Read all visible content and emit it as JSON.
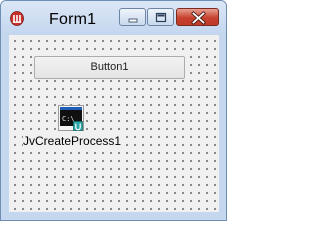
{
  "window": {
    "title": "Form1",
    "colors": {
      "frame": "#c4d7ee",
      "close_button": "#c7412e",
      "client_background": "#f0f0f0"
    },
    "icons": {
      "app": "delphi-app-icon",
      "minimize": "minimize-icon",
      "maximize": "maximize-icon",
      "close": "close-icon"
    }
  },
  "form": {
    "button1_label": "Button1",
    "component": {
      "icon": "console-command-prompt-icon",
      "label": "JvCreateProcess1"
    }
  }
}
